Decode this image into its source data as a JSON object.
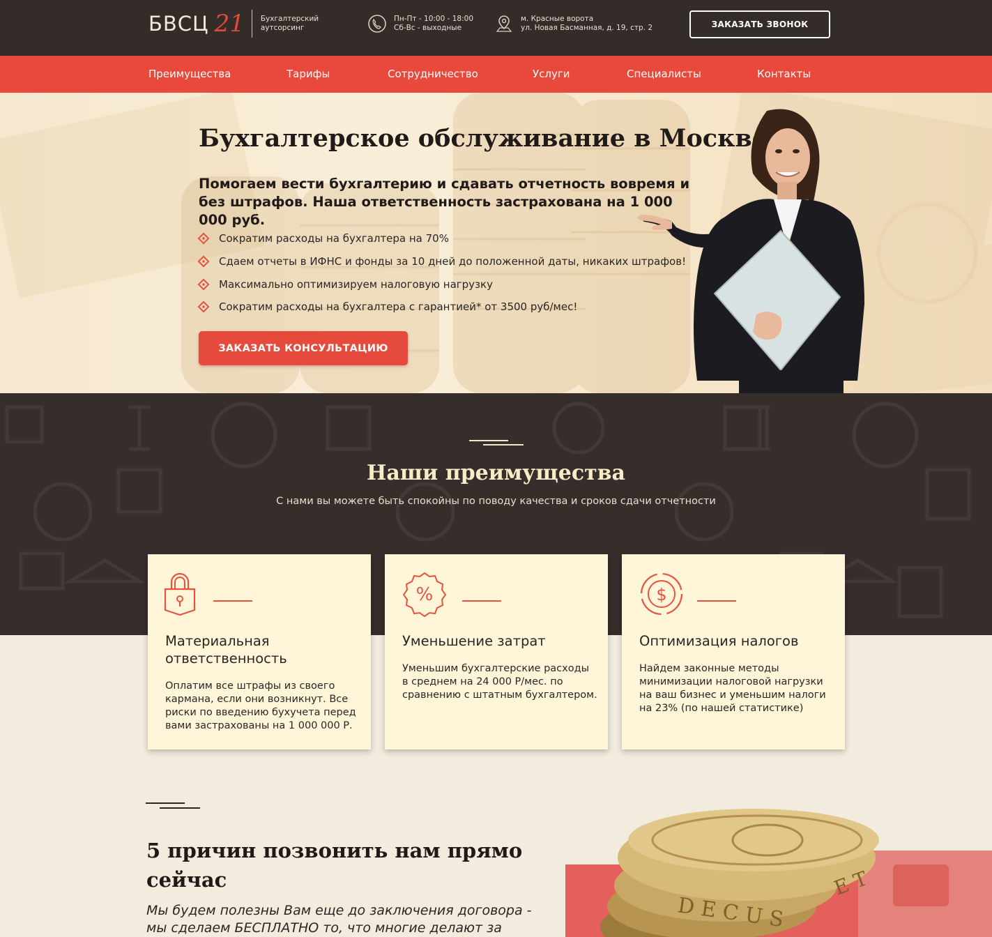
{
  "header": {
    "logo": {
      "mark": "БВСЦ",
      "number": "21",
      "tagline": "Бухгалтерский аутсорсинг"
    },
    "hours": {
      "line1": "Пн-Пт - 10:00 - 18:00",
      "line2": "Сб-Вс - выходные"
    },
    "address": {
      "line1": "м. Красные ворота",
      "line2": "ул. Новая Басманная, д. 19, стр. 2"
    },
    "callback_label": "ЗАКАЗАТЬ ЗВОНОК"
  },
  "nav": {
    "items": [
      {
        "label": "Преимущества"
      },
      {
        "label": "Тарифы"
      },
      {
        "label": "Сотрудничество"
      },
      {
        "label": "Услуги"
      },
      {
        "label": "Специалисты"
      },
      {
        "label": "Контакты"
      }
    ]
  },
  "hero": {
    "title": "Бухгалтерское обслуживание в Москве",
    "subtitle": "Помогаем вести бухгалтерию и сдавать отчетность вовремя и без штрафов. Наша ответственность застрахована на 1 000 000 руб.",
    "bullets": [
      "Сократим расходы на бухгалтера на 70%",
      "Сдаем отчеты в ИФНС и фонды за 10 дней до положенной даты, никаких штрафов!",
      "Максимально оптимизируем налоговую нагрузку",
      "Сократим расходы на бухгалтера с гарантией* от 3500 руб/мес!"
    ],
    "cta_label": "ЗАКАЗАТЬ КОНСУЛЬТАЦИЮ"
  },
  "advantages": {
    "title": "Наши преимущества",
    "subtitle": "С нами вы можете быть спокойны по поводу качества и сроков сдачи отчетности",
    "cards": [
      {
        "icon": "padlock-icon",
        "title": "Материальная ответственность",
        "text": "Оплатим все штрафы из своего кармана, если они возникнут. Все риски по введению бухучета перед вами застрахованы на 1 000 000 Р."
      },
      {
        "icon": "percent-badge-icon",
        "title": "Уменьшение затрат",
        "text": "Уменьшим бухгалтерские расходы в среднем на 24 000 Р/мес. по сравнению с штатным бухгалтером."
      },
      {
        "icon": "dollar-target-icon",
        "title": "Оптимизация налогов",
        "text": "Найдем законные методы минимизации налоговой нагрузки на ваш бизнес и уменьшим налоги на 23% (по нашей статистике)"
      }
    ]
  },
  "reasons": {
    "title": "5 причин позвонить нам прямо сейчас",
    "subtitle": "Мы будем полезны Вам еще до заключения договора - мы сделаем БЕСПЛАТНО то, что многие делают за деньги!"
  },
  "colors": {
    "accent": "#e8493b",
    "dark": "#342c29",
    "cream": "#fff6d9",
    "page": "#f2ecdf"
  }
}
